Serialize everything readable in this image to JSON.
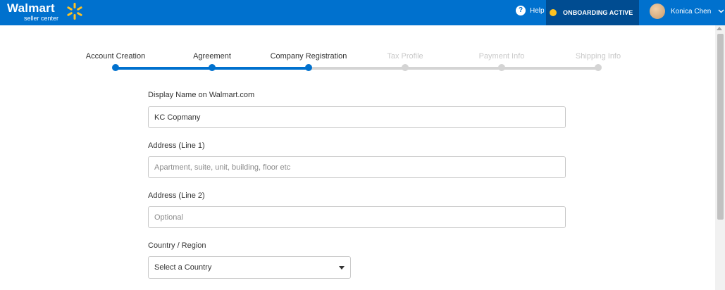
{
  "header": {
    "brand_name": "Walmart",
    "brand_sub": "seller center",
    "help_label": "Help",
    "status_label": "ONBOARDING ACTIVE",
    "user_name": "Konica Chen"
  },
  "stepper": {
    "steps": [
      {
        "label": "Account Creation",
        "state": "done"
      },
      {
        "label": "Agreement",
        "state": "done"
      },
      {
        "label": "Company Registration",
        "state": "current"
      },
      {
        "label": "Tax Profile",
        "state": "pending"
      },
      {
        "label": "Payment Info",
        "state": "pending"
      },
      {
        "label": "Shipping Info",
        "state": "pending"
      }
    ]
  },
  "form": {
    "display_name": {
      "label": "Display Name on Walmart.com",
      "value": "KC Copmany"
    },
    "address1": {
      "label": "Address (Line 1)",
      "placeholder": "Apartment, suite, unit, building, floor etc"
    },
    "address2": {
      "label": "Address (Line 2)",
      "placeholder": "Optional"
    },
    "country": {
      "label": "Country / Region",
      "selected": "Select a Country"
    }
  },
  "colors": {
    "brand_blue": "#0071ce",
    "dark_blue": "#004c91",
    "spark_yellow": "#ffc220",
    "progress_done": "#0071ce",
    "progress_pending": "#d4d4d4"
  }
}
